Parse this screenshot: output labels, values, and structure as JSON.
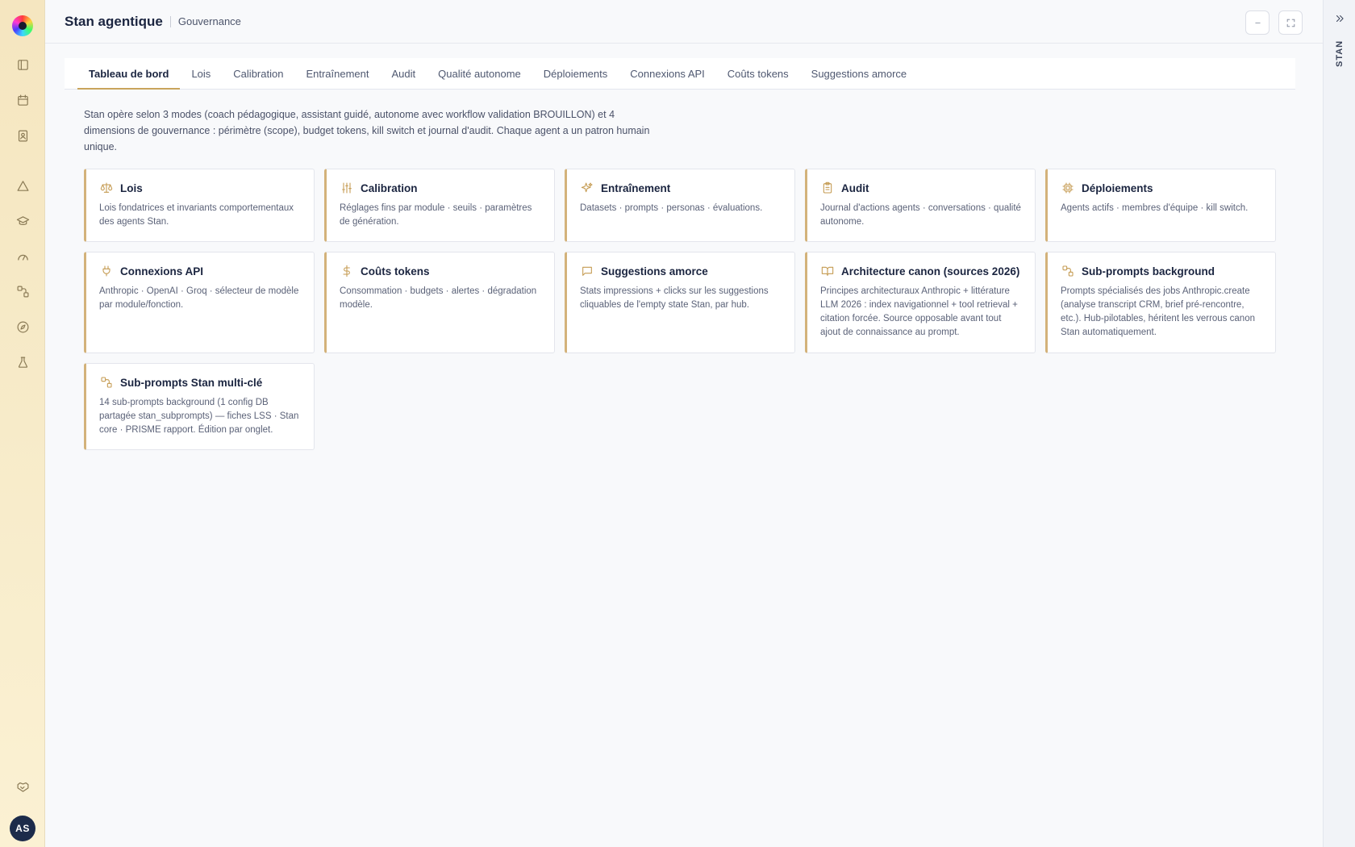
{
  "app": {
    "title": "Stan agentique",
    "subtitle": "Gouvernance"
  },
  "sidebar": {
    "items": [
      {
        "name": "panel-icon"
      },
      {
        "name": "calendar-icon"
      },
      {
        "name": "contact-book-icon"
      },
      {
        "name": "alert-triangle-icon"
      },
      {
        "name": "graduation-cap-icon"
      },
      {
        "name": "gauge-icon"
      },
      {
        "name": "workflow-icon"
      },
      {
        "name": "compass-icon"
      },
      {
        "name": "flask-icon"
      },
      {
        "name": "handshake-icon"
      }
    ],
    "avatar_initials": "AS"
  },
  "right_panel": {
    "label": "STAN"
  },
  "tabs": [
    {
      "label": "Tableau de bord",
      "active": true
    },
    {
      "label": "Lois"
    },
    {
      "label": "Calibration"
    },
    {
      "label": "Entraînement"
    },
    {
      "label": "Audit"
    },
    {
      "label": "Qualité autonome"
    },
    {
      "label": "Déploiements"
    },
    {
      "label": "Connexions API"
    },
    {
      "label": "Coûts tokens"
    },
    {
      "label": "Suggestions amorce"
    }
  ],
  "intro": "Stan opère selon 3 modes (coach pédagogique, assistant guidé, autonome avec workflow validation BROUILLON) et 4 dimensions de gouvernance : périmètre (scope), budget tokens, kill switch et journal d'audit. Chaque agent a un patron humain unique.",
  "cards": [
    {
      "title": "Lois",
      "icon": "scale-icon",
      "desc": "Lois fondatrices et invariants comportementaux des agents Stan."
    },
    {
      "title": "Calibration",
      "icon": "sliders-icon",
      "desc": "Réglages fins par module · seuils · paramètres de génération."
    },
    {
      "title": "Entraînement",
      "icon": "sparkles-icon",
      "desc": "Datasets · prompts · personas · évaluations."
    },
    {
      "title": "Audit",
      "icon": "clipboard-icon",
      "desc": "Journal d'actions agents · conversations · qualité autonome."
    },
    {
      "title": "Déploiements",
      "icon": "cpu-icon",
      "desc": "Agents actifs · membres d'équipe · kill switch."
    },
    {
      "title": "Connexions API",
      "icon": "plug-icon",
      "desc": "Anthropic · OpenAI · Groq · sélecteur de modèle par module/fonction."
    },
    {
      "title": "Coûts tokens",
      "icon": "dollar-icon",
      "desc": "Consommation · budgets · alertes · dégradation modèle."
    },
    {
      "title": "Suggestions amorce",
      "icon": "message-square-icon",
      "desc": "Stats impressions + clicks sur les suggestions cliquables de l'empty state Stan, par hub."
    },
    {
      "title": "Architecture canon (sources 2026)",
      "icon": "book-open-icon",
      "desc": "Principes architecturaux Anthropic + littérature LLM 2026 : index navigationnel + tool retrieval + citation forcée. Source opposable avant tout ajout de connaissance au prompt."
    },
    {
      "title": "Sub-prompts background",
      "icon": "workflow-icon",
      "desc": "Prompts spécialisés des jobs Anthropic.create (analyse transcript CRM, brief pré-rencontre, etc.). Hub-pilotables, héritent les verrous canon Stan automatiquement."
    },
    {
      "title": "Sub-prompts Stan multi-clé",
      "icon": "workflow-icon",
      "desc": "14 sub-prompts background (1 config DB partagée stan_subprompts) — fiches LSS · Stan core · PRISME rapport. Édition par onglet."
    }
  ],
  "colors": {
    "accent": "#c9a45c",
    "card_border_left": "#d3b27a",
    "title": "#1b2540",
    "avatar_bg": "#1c2b4a"
  }
}
